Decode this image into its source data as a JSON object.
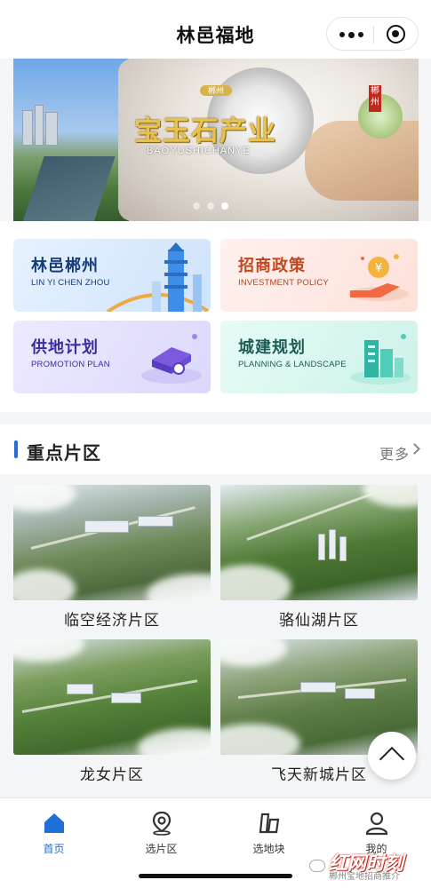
{
  "header": {
    "title": "林邑福地"
  },
  "banner": {
    "title": "宝玉石产业",
    "subtitle": "BAOYUSHICHANYE",
    "deco_text": "郴州",
    "seal_text": "郴州",
    "active_slide": 3,
    "slide_count": 3
  },
  "cards": [
    {
      "title": "林邑郴州",
      "subtitle": "LIN YI CHEN ZHOU"
    },
    {
      "title": "招商政策",
      "subtitle": "INVESTMENT POLICY"
    },
    {
      "title": "供地计划",
      "subtitle": "PROMOTION PLAN"
    },
    {
      "title": "城建规划",
      "subtitle": "PLANNING & LANDSCAPE"
    }
  ],
  "section": {
    "title": "重点片区",
    "more": "更多"
  },
  "districts": [
    {
      "name": "临空经济片区"
    },
    {
      "name": "骆仙湖片区"
    },
    {
      "name": "龙女片区"
    },
    {
      "name": "飞天新城片区"
    }
  ],
  "tabs": [
    {
      "label": "首页",
      "active": true
    },
    {
      "label": "选片区",
      "active": false
    },
    {
      "label": "选地块",
      "active": false
    },
    {
      "label": "我的",
      "active": false
    }
  ],
  "watermark": {
    "logo": "红网时刻",
    "text": "郴州宝地招商推介"
  },
  "colors": {
    "accent": "#1f6fd6",
    "banner_gold": "#e9c24d"
  }
}
